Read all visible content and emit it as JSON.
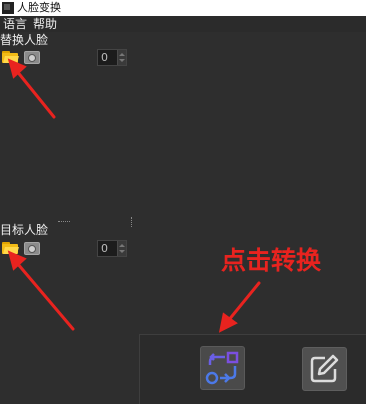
{
  "window": {
    "title": "人脸变换"
  },
  "menu": {
    "items": [
      {
        "label": "语言"
      },
      {
        "label": "帮助"
      }
    ]
  },
  "source": {
    "label": "替换人脸",
    "spin_value": "0"
  },
  "target": {
    "label": "目标人脸",
    "spin_value": "0"
  },
  "annotation": {
    "text": "点击转换",
    "color": "#e8231f"
  },
  "actions": {
    "swap_icon": "swap-arrows-icon",
    "edit_icon": "edit-icon"
  },
  "colors": {
    "background": "#2e2e2e",
    "folder": "#f2bb16",
    "swap_accent": "#7b4fe0"
  }
}
